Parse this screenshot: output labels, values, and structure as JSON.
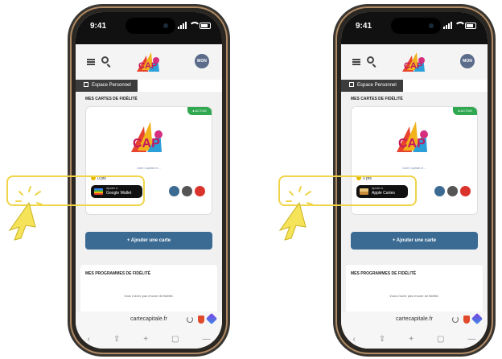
{
  "status": {
    "time": "9:41"
  },
  "header": {
    "avatar_text": "MON"
  },
  "espace_personnel": "Espace Personnel",
  "cards_section": {
    "title": "MES CARTES DE FIDÉLITÉ",
    "badge": "● ACTIVE",
    "card_subtitle": "Carte Capitale et ...",
    "points": "0 pts"
  },
  "wallet_buttons": [
    {
      "line1": "Ajouter à",
      "line2": "Google Wallet",
      "icon": "google-wallet-icon"
    },
    {
      "line1": "Ajouter à",
      "line2": "Apple Cartes",
      "icon": "apple-wallet-icon"
    }
  ],
  "add_card_label": "+ Ajouter une carte",
  "programs_section": {
    "title": "MES PROGRAMMES DE FIDÉLITÉ",
    "empty_text": "Vous n'avez pas encore de fidélité."
  },
  "browser": {
    "url": "cartecapitale.fr"
  },
  "colors": {
    "accent": "#3b6b93",
    "highlight": "#f0d44a",
    "active_badge": "#2fa84f"
  }
}
